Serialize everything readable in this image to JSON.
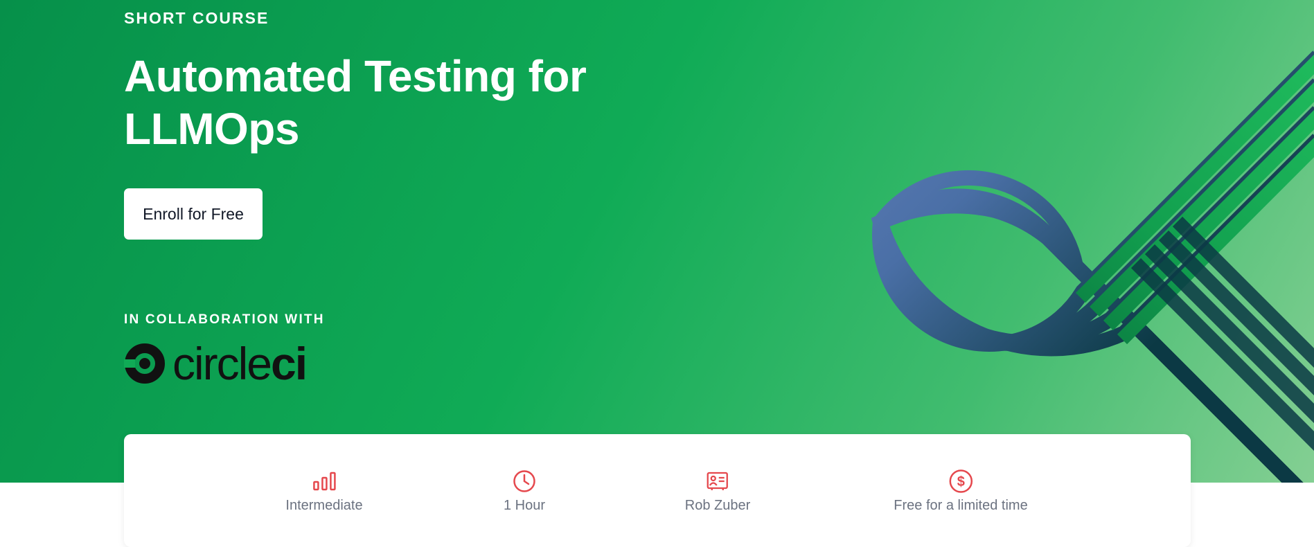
{
  "hero": {
    "eyebrow": "SHORT COURSE",
    "title": "Automated Testing for LLMOps",
    "enroll_label": "Enroll for Free",
    "collab_label": "IN COLLABORATION WITH",
    "partner_logo_text": "circleci"
  },
  "stats": [
    {
      "icon": "bar-chart-icon",
      "label": "Intermediate"
    },
    {
      "icon": "clock-icon",
      "label": "1 Hour"
    },
    {
      "icon": "instructor-icon",
      "label": "Rob Zuber"
    },
    {
      "icon": "dollar-icon",
      "label": "Free for a limited time"
    }
  ],
  "colors": {
    "hero_green": "#10ab56",
    "accent_red": "#e5484d",
    "art_blue": "#5b7fb5",
    "art_dark": "#0c3a45"
  }
}
